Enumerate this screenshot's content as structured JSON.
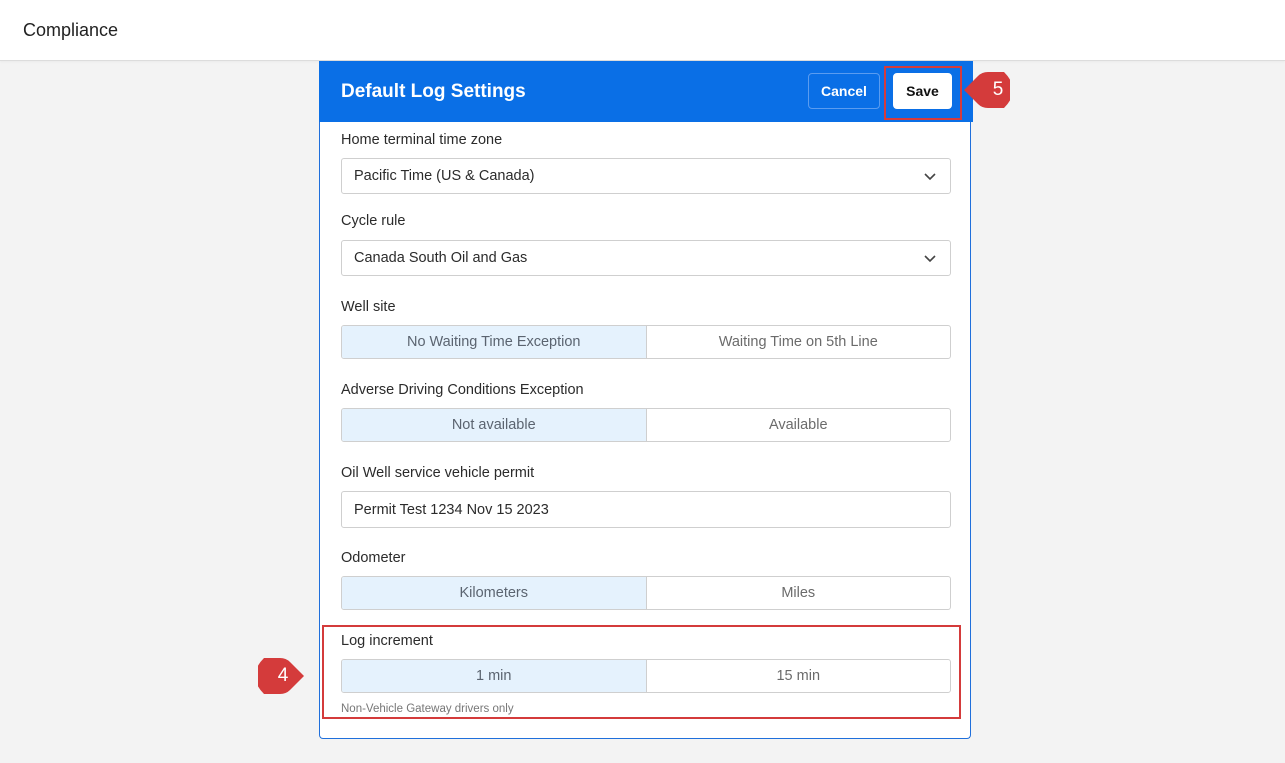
{
  "header": {
    "title": "Compliance"
  },
  "panel": {
    "title": "Default Log Settings",
    "cancel_label": "Cancel",
    "save_label": "Save"
  },
  "fields": {
    "time_zone": {
      "label": "Home terminal time zone",
      "value": "Pacific Time (US & Canada)",
      "icon": "chevron-down-icon"
    },
    "cycle_rule": {
      "label": "Cycle rule",
      "value": "Canada South Oil and Gas",
      "icon": "chevron-down-icon"
    },
    "well_site": {
      "label": "Well site",
      "options": [
        "No Waiting Time Exception",
        "Waiting Time on 5th Line"
      ],
      "selected": "No Waiting Time Exception"
    },
    "adverse": {
      "label": "Adverse Driving Conditions Exception",
      "options": [
        "Not available",
        "Available"
      ],
      "selected": "Not available"
    },
    "permit": {
      "label": "Oil Well service vehicle permit",
      "value": "Permit Test 1234 Nov 15 2023"
    },
    "odometer": {
      "label": "Odometer",
      "options": [
        "Kilometers",
        "Miles"
      ],
      "selected": "Kilometers"
    },
    "log_increment": {
      "label": "Log increment",
      "options": [
        "1 min",
        "15 min"
      ],
      "selected": "1 min",
      "hint": "Non-Vehicle Gateway drivers only"
    }
  },
  "annotations": {
    "step_save": "5",
    "step_log_increment": "4",
    "highlight_color": "#d43b3b"
  },
  "colors": {
    "header_blue": "#0a6fe6",
    "selected_segment": "#e5f2fd"
  }
}
